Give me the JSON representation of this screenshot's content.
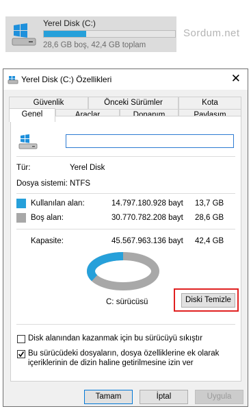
{
  "tile": {
    "title": "Yerel Disk (C:)",
    "subtitle": "28,6 GB boş, 42,4 GB toplam",
    "used_fraction": 0.325
  },
  "watermark": "Sordum.net",
  "dialog": {
    "title": "Yerel Disk (C:) Özellikleri",
    "close_label": "✕",
    "tabs_back": [
      "Güvenlik",
      "Önceki Sürümler",
      "Kota"
    ],
    "tabs_front": [
      "Genel",
      "Araçlar",
      "Donanım",
      "Paylaşım"
    ],
    "active_tab": "Genel",
    "drive_name_value": "",
    "type_label": "Tür:",
    "type_value": "Yerel Disk",
    "fs_label": "Dosya sistemi:",
    "fs_value": "NTFS",
    "used": {
      "label": "Kullanılan alan:",
      "bytes": "14.797.180.928 bayt",
      "size": "13,7 GB",
      "color": "#26a0da"
    },
    "free": {
      "label": "Boş alan:",
      "bytes": "30.770.782.208 bayt",
      "size": "28,6 GB",
      "color": "#a8a8a8"
    },
    "capacity": {
      "label": "Kapasite:",
      "bytes": "45.567.963.136 bayt",
      "size": "42,4 GB"
    },
    "drive_label": "C: sürücüsü",
    "cleanup_button": "Diski Temizle",
    "compress_checkbox": {
      "label": "Disk alanından kazanmak için bu sürücüyü sıkıştır",
      "checked": false
    },
    "index_checkbox": {
      "label_line1": "Bu sürücüdeki dosyaların, dosya özelliklerine ek olarak",
      "label_line2": "içeriklerinin de dizin haline getirilmesine izin ver",
      "checked": true
    },
    "ok_button": "Tamam",
    "cancel_button": "İptal",
    "apply_button": "Uygula"
  }
}
